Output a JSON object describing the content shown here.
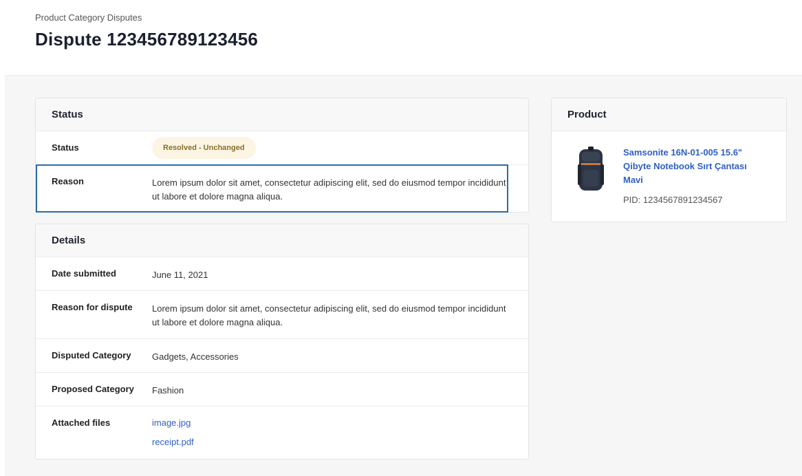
{
  "header": {
    "breadcrumb": "Product Category Disputes",
    "title": "Dispute 123456789123456"
  },
  "status_card": {
    "title": "Status",
    "rows": [
      {
        "label": "Status",
        "badge": "Resolved - Unchanged"
      },
      {
        "label": "Reason",
        "value": "Lorem ipsum dolor sit amet, consectetur adipiscing elit, sed do eiusmod tempor incididunt ut labore et dolore magna aliqua."
      }
    ]
  },
  "details_card": {
    "title": "Details",
    "rows": [
      {
        "label": "Date submitted",
        "value": "June 11, 2021"
      },
      {
        "label": "Reason for dispute",
        "value": "Lorem ipsum dolor sit amet, consectetur adipiscing elit, sed do eiusmod tempor incididunt ut labore et dolore magna aliqua."
      },
      {
        "label": "Disputed Category",
        "value": "Gadgets, Accessories"
      },
      {
        "label": "Proposed Category",
        "value": "Fashion"
      },
      {
        "label": "Attached files",
        "files": [
          "image.jpg",
          "receipt.pdf"
        ]
      }
    ]
  },
  "product_card": {
    "title": "Product",
    "name": "Samsonite 16N-01-005 15.6\" Qibyte Notebook Sırt Çantası Mavi",
    "pid": "PID: 1234567891234567",
    "thumbnail_icon": "backpack-icon"
  },
  "colors": {
    "link": "#2f5fc7",
    "badge_bg": "#fdf5e3",
    "badge_text": "#8a6d2c",
    "highlight": "#2b6aa8"
  }
}
